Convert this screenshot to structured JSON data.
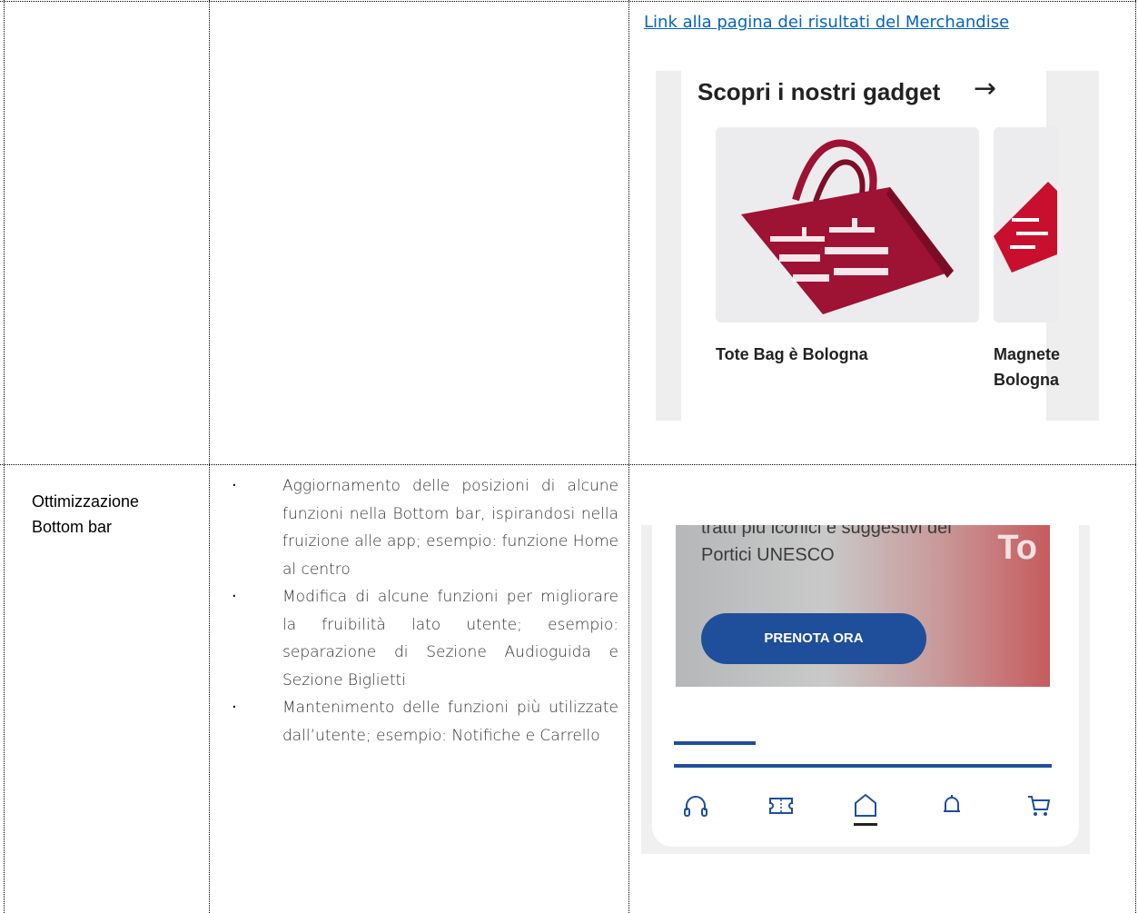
{
  "row1": {
    "link_text": "Link alla pagina dei risultati del Merchandise",
    "screenshot": {
      "title": "Scopri i nostri gadget",
      "arrow_icon": "arrow-right-icon",
      "cards": [
        {
          "lines": [
            "Tote Bag è Bologna"
          ]
        },
        {
          "lines": [
            "Magnete",
            "Bologna"
          ]
        }
      ]
    }
  },
  "row2": {
    "label_lines": [
      "Ottimizzazione",
      "Bottom bar"
    ],
    "bullets": [
      "Aggiornamento delle posizioni di alcune funzioni nella Bottom bar, ispirandosi nella fruizione alle app; esempio: funzione Home al centro",
      "Modifica di alcune funzioni per migliorare la fruibilità lato utente; esempio: separazione di Sezione Audioguida e Sezione Biglietti",
      "Mantenimento delle funzioni più utilizzate dall’utente; esempio: Notifiche e Carrello"
    ],
    "screenshot": {
      "description_lines": [
        "tratti più iconici e suggestivi dei",
        "Portici UNESCO"
      ],
      "button_label": "PRENOTA ORA",
      "banner_corner_text": "To",
      "bottom_bar_icons": [
        "headphones-icon",
        "ticket-icon",
        "home-icon",
        "bell-icon",
        "cart-icon"
      ],
      "colors": {
        "accent": "#1f4f9a",
        "product": "#9e1233"
      }
    }
  }
}
